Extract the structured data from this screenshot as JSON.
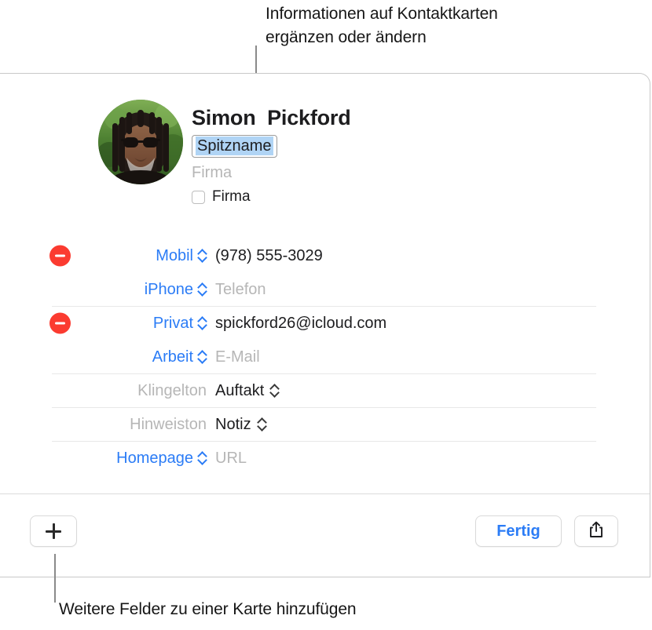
{
  "annotations": {
    "top_callout": "Informationen auf Kontaktkarten\nergänzen oder ändern",
    "bottom_callout": "Weitere Felder zu einer Karte hinzufügen"
  },
  "card": {
    "header": {
      "avatar_alt": "contact-photo",
      "first_name": "Simon",
      "last_name": "Pickford",
      "full_name": "Simon  Pickford",
      "nickname_value": "Spitzname",
      "company_placeholder": "Firma",
      "company_checkbox_label": "Firma",
      "company_checked": false
    },
    "fields": [
      {
        "label": "Mobil",
        "label_color": "blue",
        "chevron": "blue",
        "value": "(978) 555-3029",
        "value_state": "filled",
        "has_remove": true,
        "separator_above": false,
        "value_chevron": null
      },
      {
        "label": "iPhone",
        "label_color": "blue",
        "chevron": "blue",
        "value": "Telefon",
        "value_state": "placeholder",
        "has_remove": false,
        "separator_above": false,
        "value_chevron": null
      },
      {
        "label": "Privat",
        "label_color": "blue",
        "chevron": "blue",
        "value": "spickford26@icloud.com",
        "value_state": "filled",
        "has_remove": true,
        "separator_above": true,
        "value_chevron": null
      },
      {
        "label": "Arbeit",
        "label_color": "blue",
        "chevron": "blue",
        "value": "E-Mail",
        "value_state": "placeholder",
        "has_remove": false,
        "separator_above": false,
        "value_chevron": null
      },
      {
        "label": "Klingelton",
        "label_color": "gray",
        "chevron": null,
        "value": "Auftakt",
        "value_state": "filled",
        "has_remove": false,
        "separator_above": true,
        "value_chevron": "dark"
      },
      {
        "label": "Hinweiston",
        "label_color": "gray",
        "chevron": null,
        "value": "Notiz",
        "value_state": "filled",
        "has_remove": false,
        "separator_above": true,
        "value_chevron": "dark"
      },
      {
        "label": "Homepage",
        "label_color": "blue",
        "chevron": "blue",
        "value": "URL",
        "value_state": "placeholder",
        "has_remove": false,
        "separator_above": true,
        "value_chevron": null
      }
    ],
    "toolbar": {
      "add_field_icon": "plus-icon",
      "done_label": "Fertig",
      "share_icon": "share-icon"
    }
  },
  "colors": {
    "accent_blue": "#2b7cf6",
    "remove_red": "#fb3b30",
    "placeholder_gray": "#b6b6b6",
    "selection_blue": "#b0d4f5",
    "card_border": "#c8c8c8",
    "row_divider": "#e8e8e8"
  }
}
